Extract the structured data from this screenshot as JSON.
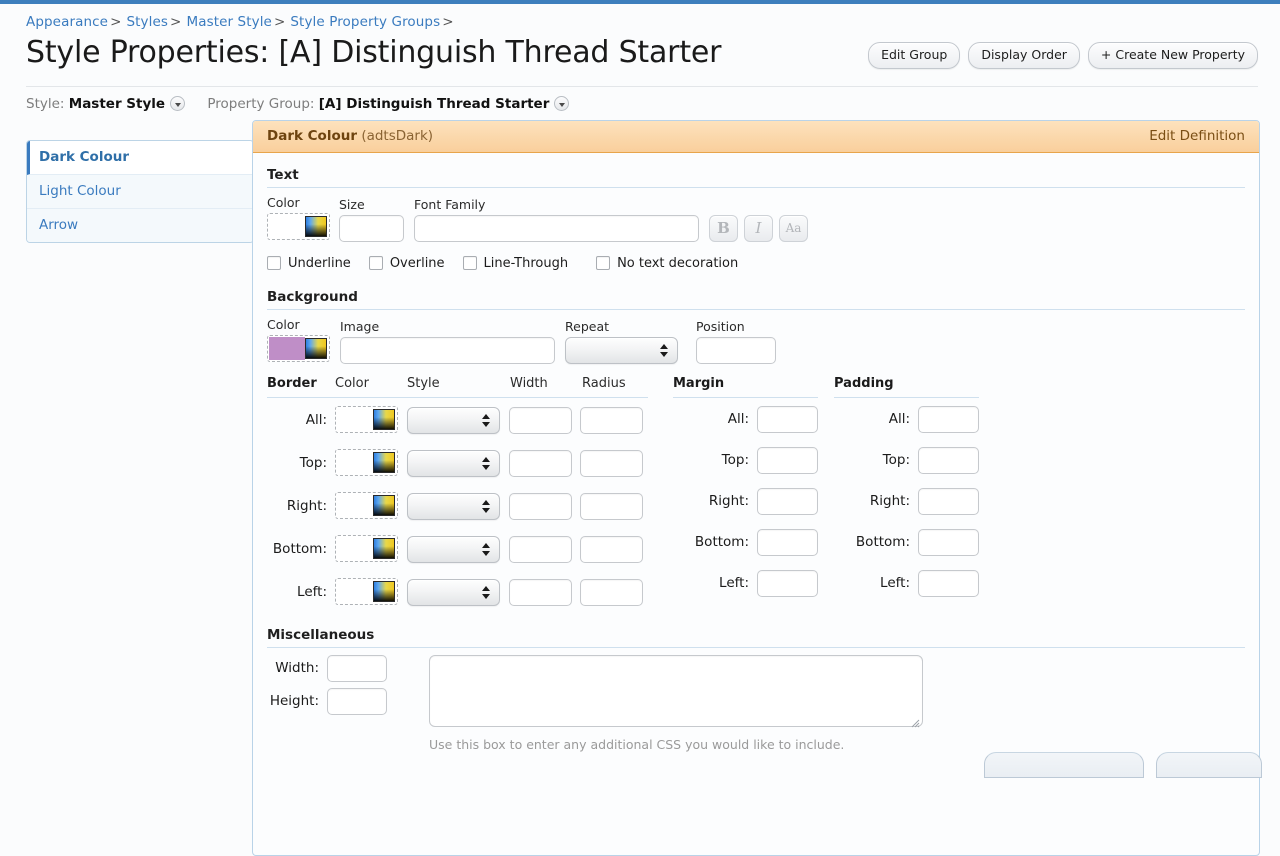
{
  "topbar": {
    "color": "#3e7fbd"
  },
  "breadcrumb": {
    "items": [
      {
        "label": "Appearance",
        "sep": ">"
      },
      {
        "label": "Styles",
        "sep": ">"
      },
      {
        "label": "Master Style",
        "sep": ">"
      },
      {
        "label": "Style Property Groups",
        "sep": ">"
      }
    ]
  },
  "page": {
    "title": "Style Properties: [A] Distinguish Thread Starter"
  },
  "header_buttons": [
    {
      "label": "Edit Group"
    },
    {
      "label": "Display Order"
    },
    {
      "label": "+ Create New Property"
    }
  ],
  "selectors": {
    "style_label": "Style:",
    "style_value": "Master Style",
    "group_label": "Property Group:",
    "group_value": "[A] Distinguish Thread Starter",
    "chevron_icon": "chevron-down-icon"
  },
  "sidebar": {
    "items": [
      {
        "label": "Dark Colour",
        "active": true
      },
      {
        "label": "Light Colour",
        "active": false
      },
      {
        "label": "Arrow",
        "active": false
      }
    ]
  },
  "panel": {
    "header": {
      "title": "Dark Colour",
      "code": "(adtsDark)",
      "edit_link": "Edit Definition",
      "bg_start": "#fde2bd",
      "bg_end": "#f9cf9c",
      "border": "#e8a54b"
    },
    "text_section": {
      "title": "Text",
      "color_label": "Color",
      "color_value": "",
      "size_label": "Size",
      "size_value": "",
      "font_label": "Font Family",
      "font_value": "",
      "bold_label": "B",
      "italic_label": "I",
      "caps_label": "Aa",
      "checkboxes": [
        {
          "label": "Underline",
          "checked": false
        },
        {
          "label": "Overline",
          "checked": false
        },
        {
          "label": "Line-Through",
          "checked": false
        },
        {
          "label": "No text decoration",
          "checked": false
        }
      ]
    },
    "background_section": {
      "title": "Background",
      "color_label": "Color",
      "color_swatch": "#bf8ec7",
      "image_label": "Image",
      "image_value": "",
      "repeat_label": "Repeat",
      "repeat_value": "",
      "position_label": "Position",
      "position_value": ""
    },
    "border_section": {
      "title": "Border",
      "col_color": "Color",
      "col_style": "Style",
      "col_width": "Width",
      "col_radius": "Radius",
      "margin_title": "Margin",
      "padding_title": "Padding",
      "rows": [
        {
          "label": "All:",
          "color": "",
          "style": "",
          "width": "",
          "radius": ""
        },
        {
          "label": "Top:",
          "color": "",
          "style": "",
          "width": "",
          "radius": ""
        },
        {
          "label": "Right:",
          "color": "",
          "style": "",
          "width": "",
          "radius": ""
        },
        {
          "label": "Bottom:",
          "color": "",
          "style": "",
          "width": "",
          "radius": ""
        },
        {
          "label": "Left:",
          "color": "",
          "style": "",
          "width": "",
          "radius": ""
        }
      ],
      "margin_rows": [
        {
          "label": "All:",
          "value": ""
        },
        {
          "label": "Top:",
          "value": ""
        },
        {
          "label": "Right:",
          "value": ""
        },
        {
          "label": "Bottom:",
          "value": ""
        },
        {
          "label": "Left:",
          "value": ""
        }
      ],
      "padding_rows": [
        {
          "label": "All:",
          "value": ""
        },
        {
          "label": "Top:",
          "value": ""
        },
        {
          "label": "Right:",
          "value": ""
        },
        {
          "label": "Bottom:",
          "value": ""
        },
        {
          "label": "Left:",
          "value": ""
        }
      ]
    },
    "misc_section": {
      "title": "Miscellaneous",
      "width_label": "Width:",
      "width_value": "",
      "height_label": "Height:",
      "height_value": "",
      "css_value": "",
      "css_hint": "Use this box to enter any additional CSS you would like to include."
    }
  }
}
